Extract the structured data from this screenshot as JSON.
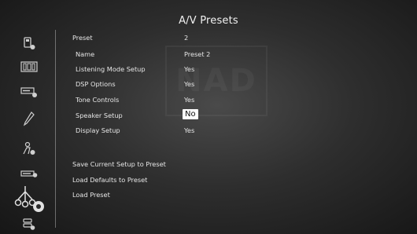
{
  "title": "A/V Presets",
  "watermark": "NAD",
  "settings": [
    {
      "label": "Preset",
      "value": "2"
    },
    {
      "label": "Name",
      "value": "Preset 2"
    },
    {
      "label": "Listening Mode Setup",
      "value": "Yes"
    },
    {
      "label": "DSP Options",
      "value": "Yes"
    },
    {
      "label": "Tone Controls",
      "value": "Yes"
    },
    {
      "label": "Speaker Setup",
      "value": "No"
    },
    {
      "label": "Display Setup",
      "value": "Yes"
    }
  ],
  "actions": [
    {
      "label": "Save Current Setup to Preset"
    },
    {
      "label": "Load Defaults to Preset"
    },
    {
      "label": "Load Preset"
    }
  ],
  "sidebar_icons": [
    "source-setup-icon",
    "speaker-setup-icon",
    "display-setup-icon",
    "audio-tweak-icon",
    "listening-mode-icon",
    "amplifier-icon",
    "av-presets-icon",
    "system-icon"
  ]
}
